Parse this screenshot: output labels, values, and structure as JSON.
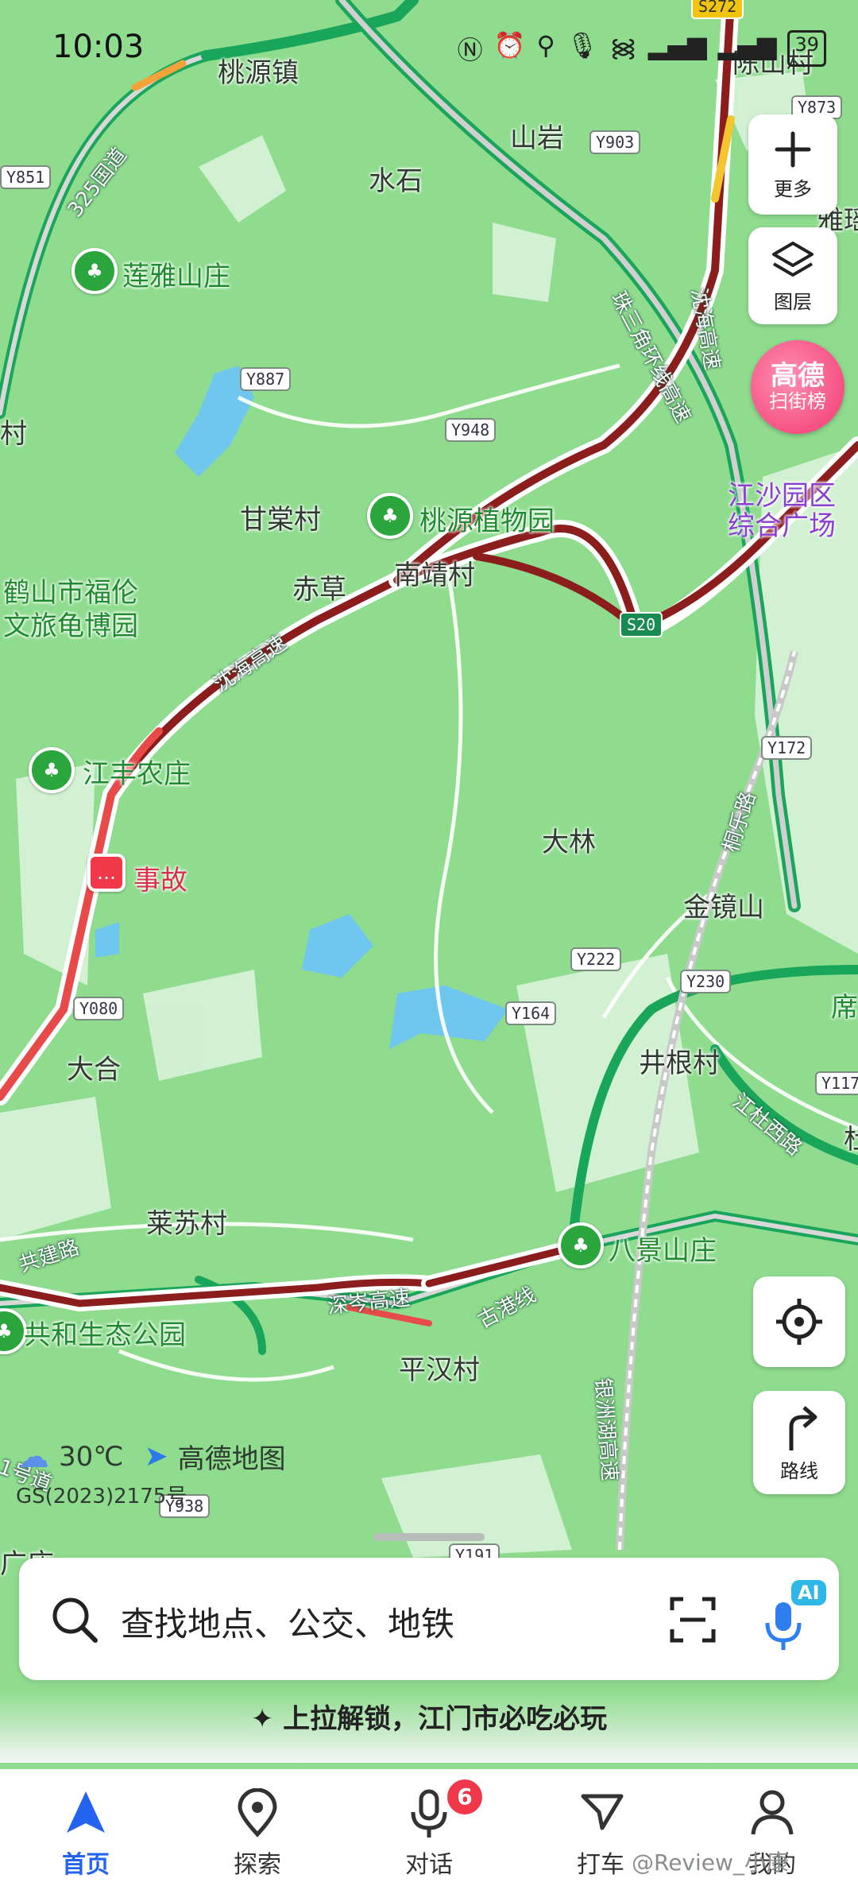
{
  "status_bar": {
    "time": "10:03",
    "icons": [
      "nfc-icon",
      "alarm-icon",
      "location-icon",
      "mic-icon",
      "wifi-icon",
      "signal-icon",
      "signal-icon",
      "battery-icon"
    ],
    "battery": "39"
  },
  "map": {
    "places": [
      "桃源镇",
      "陈山村",
      "山岩",
      "水石",
      "雅瑶",
      "莲雅山庄",
      "甘棠村",
      "桃源植物园",
      "赤草",
      "南靖村",
      "鹤山市福伦",
      "文旅龟博园",
      "江丰农庄",
      "大林",
      "金镜山",
      "事故",
      "大合",
      "井根村",
      "席",
      "莱苏村",
      "八景山庄",
      "共和生态公园",
      "平汉村",
      "村",
      "杜",
      "广庄",
      "江沙园区",
      "综合广场"
    ],
    "road_badges": [
      "Y851",
      "Y873",
      "Y903",
      "Y887",
      "Y948",
      "Y172",
      "Y222",
      "Y230",
      "Y080",
      "Y164",
      "Y117",
      "Y938",
      "Y191",
      "S272",
      "S20"
    ],
    "road_names": [
      "325国道",
      "沈海高速",
      "珠三角环线高速",
      "沈海高速",
      "桐乐路",
      "江杜西路",
      "共建路",
      "深岑高速",
      "古港线",
      "银洲湖高速",
      "1号道"
    ]
  },
  "controls": {
    "more": "更多",
    "layers": "图层",
    "route": "路线"
  },
  "gaode_rank": {
    "line1": "高德",
    "line2": "扫街榜"
  },
  "weather": {
    "temp": "30℃",
    "brand": "高德地图"
  },
  "gs_number": "GS(2023)2175号",
  "search": {
    "placeholder": "查找地点、公交、地铁",
    "ai": "AI"
  },
  "promo": "上拉解锁，江门市必吃必玩",
  "tabs": [
    {
      "label": "首页"
    },
    {
      "label": "探索"
    },
    {
      "label": "对话",
      "badge": "6"
    },
    {
      "label": "打车"
    },
    {
      "label": "我的"
    }
  ],
  "watermark": "@Review_小康",
  "colors": {
    "accent": "#2463f0",
    "park_green": "#2aa63c",
    "water": "#6fc6ee",
    "highway_congested": "#8b1d1d",
    "badge_red": "#f0384a"
  }
}
